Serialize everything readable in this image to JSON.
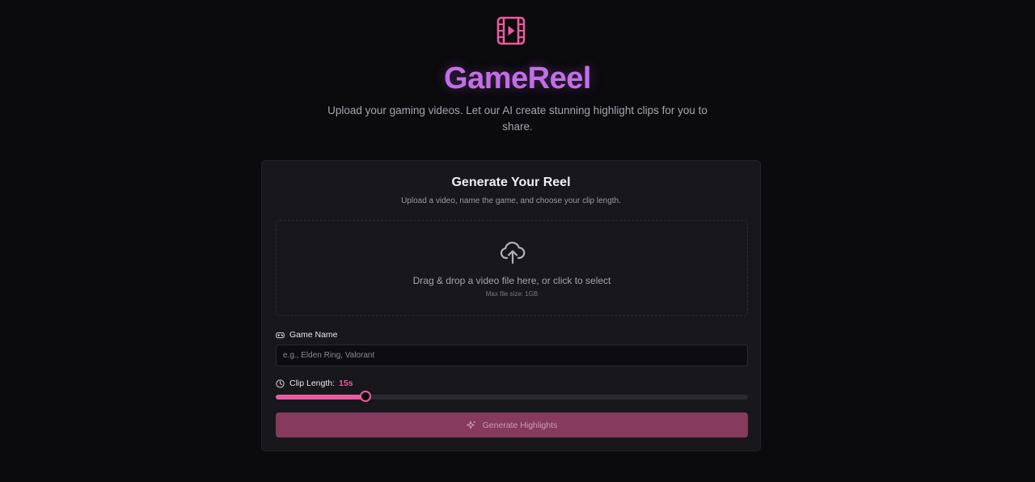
{
  "header": {
    "logo_icon": "film-play-icon",
    "title": "GameReel",
    "tagline": "Upload your gaming videos. Let our AI create stunning highlight clips for you to share."
  },
  "card": {
    "title": "Generate Your Reel",
    "subtitle": "Upload a video, name the game, and choose your clip length.",
    "dropzone": {
      "icon": "cloud-upload-icon",
      "text": "Drag & drop a video file here, or click to select",
      "hint": "Max file size: 1GB"
    },
    "game_name": {
      "icon": "gamepad-icon",
      "label": "Game Name",
      "placeholder": "e.g., Elden Ring, Valorant",
      "value": ""
    },
    "clip_length": {
      "icon": "clock-icon",
      "label": "Clip Length:",
      "value_label": "15s",
      "value_fraction": 0.19
    },
    "generate_button": {
      "icon": "sparkles-icon",
      "label": "Generate Highlights",
      "disabled": true
    }
  },
  "colors": {
    "background": "#0b0a0d",
    "card": "#18171c",
    "title_purple": "#c26ee8",
    "accent_pink": "#ec5a9e",
    "button_disabled": "#853a5e"
  }
}
